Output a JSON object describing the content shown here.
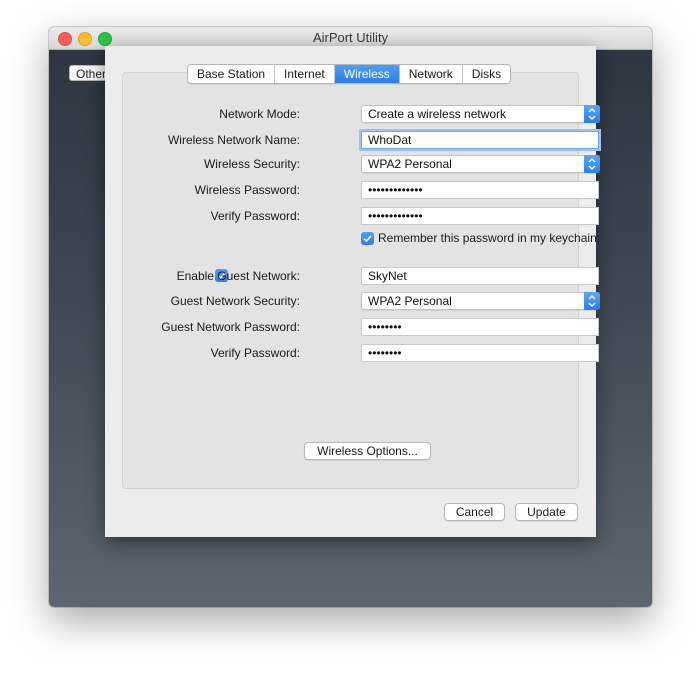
{
  "window": {
    "title": "AirPort Utility"
  },
  "background": {
    "other_button_label": "Other"
  },
  "tabs": [
    {
      "label": "Base Station",
      "active": false
    },
    {
      "label": "Internet",
      "active": false
    },
    {
      "label": "Wireless",
      "active": true
    },
    {
      "label": "Network",
      "active": false
    },
    {
      "label": "Disks",
      "active": false
    }
  ],
  "form": {
    "network_mode": {
      "label": "Network Mode:",
      "value": "Create a wireless network"
    },
    "network_name": {
      "label": "Wireless Network Name:",
      "value": "WhoDat"
    },
    "security": {
      "label": "Wireless Security:",
      "value": "WPA2 Personal"
    },
    "password": {
      "label": "Wireless Password:",
      "value": "•••••••••••••"
    },
    "verify": {
      "label": "Verify Password:",
      "value": "•••••••••••••"
    },
    "remember": {
      "label": "Remember this password in my keychain",
      "checked": true
    },
    "guest_enable": {
      "label": "Enable Guest Network:",
      "checked": true,
      "value": "SkyNet"
    },
    "guest_security": {
      "label": "Guest Network Security:",
      "value": "WPA2 Personal"
    },
    "guest_password": {
      "label": "Guest Network Password:",
      "value": "••••••••"
    },
    "guest_verify": {
      "label": "Verify Password:",
      "value": "••••••••"
    },
    "options_button": "Wireless Options..."
  },
  "footer": {
    "cancel_label": "Cancel",
    "update_label": "Update"
  },
  "colors": {
    "accent": "#2a7ee9",
    "sheet_bg": "#ececec",
    "window_bg": "#3e4753"
  }
}
